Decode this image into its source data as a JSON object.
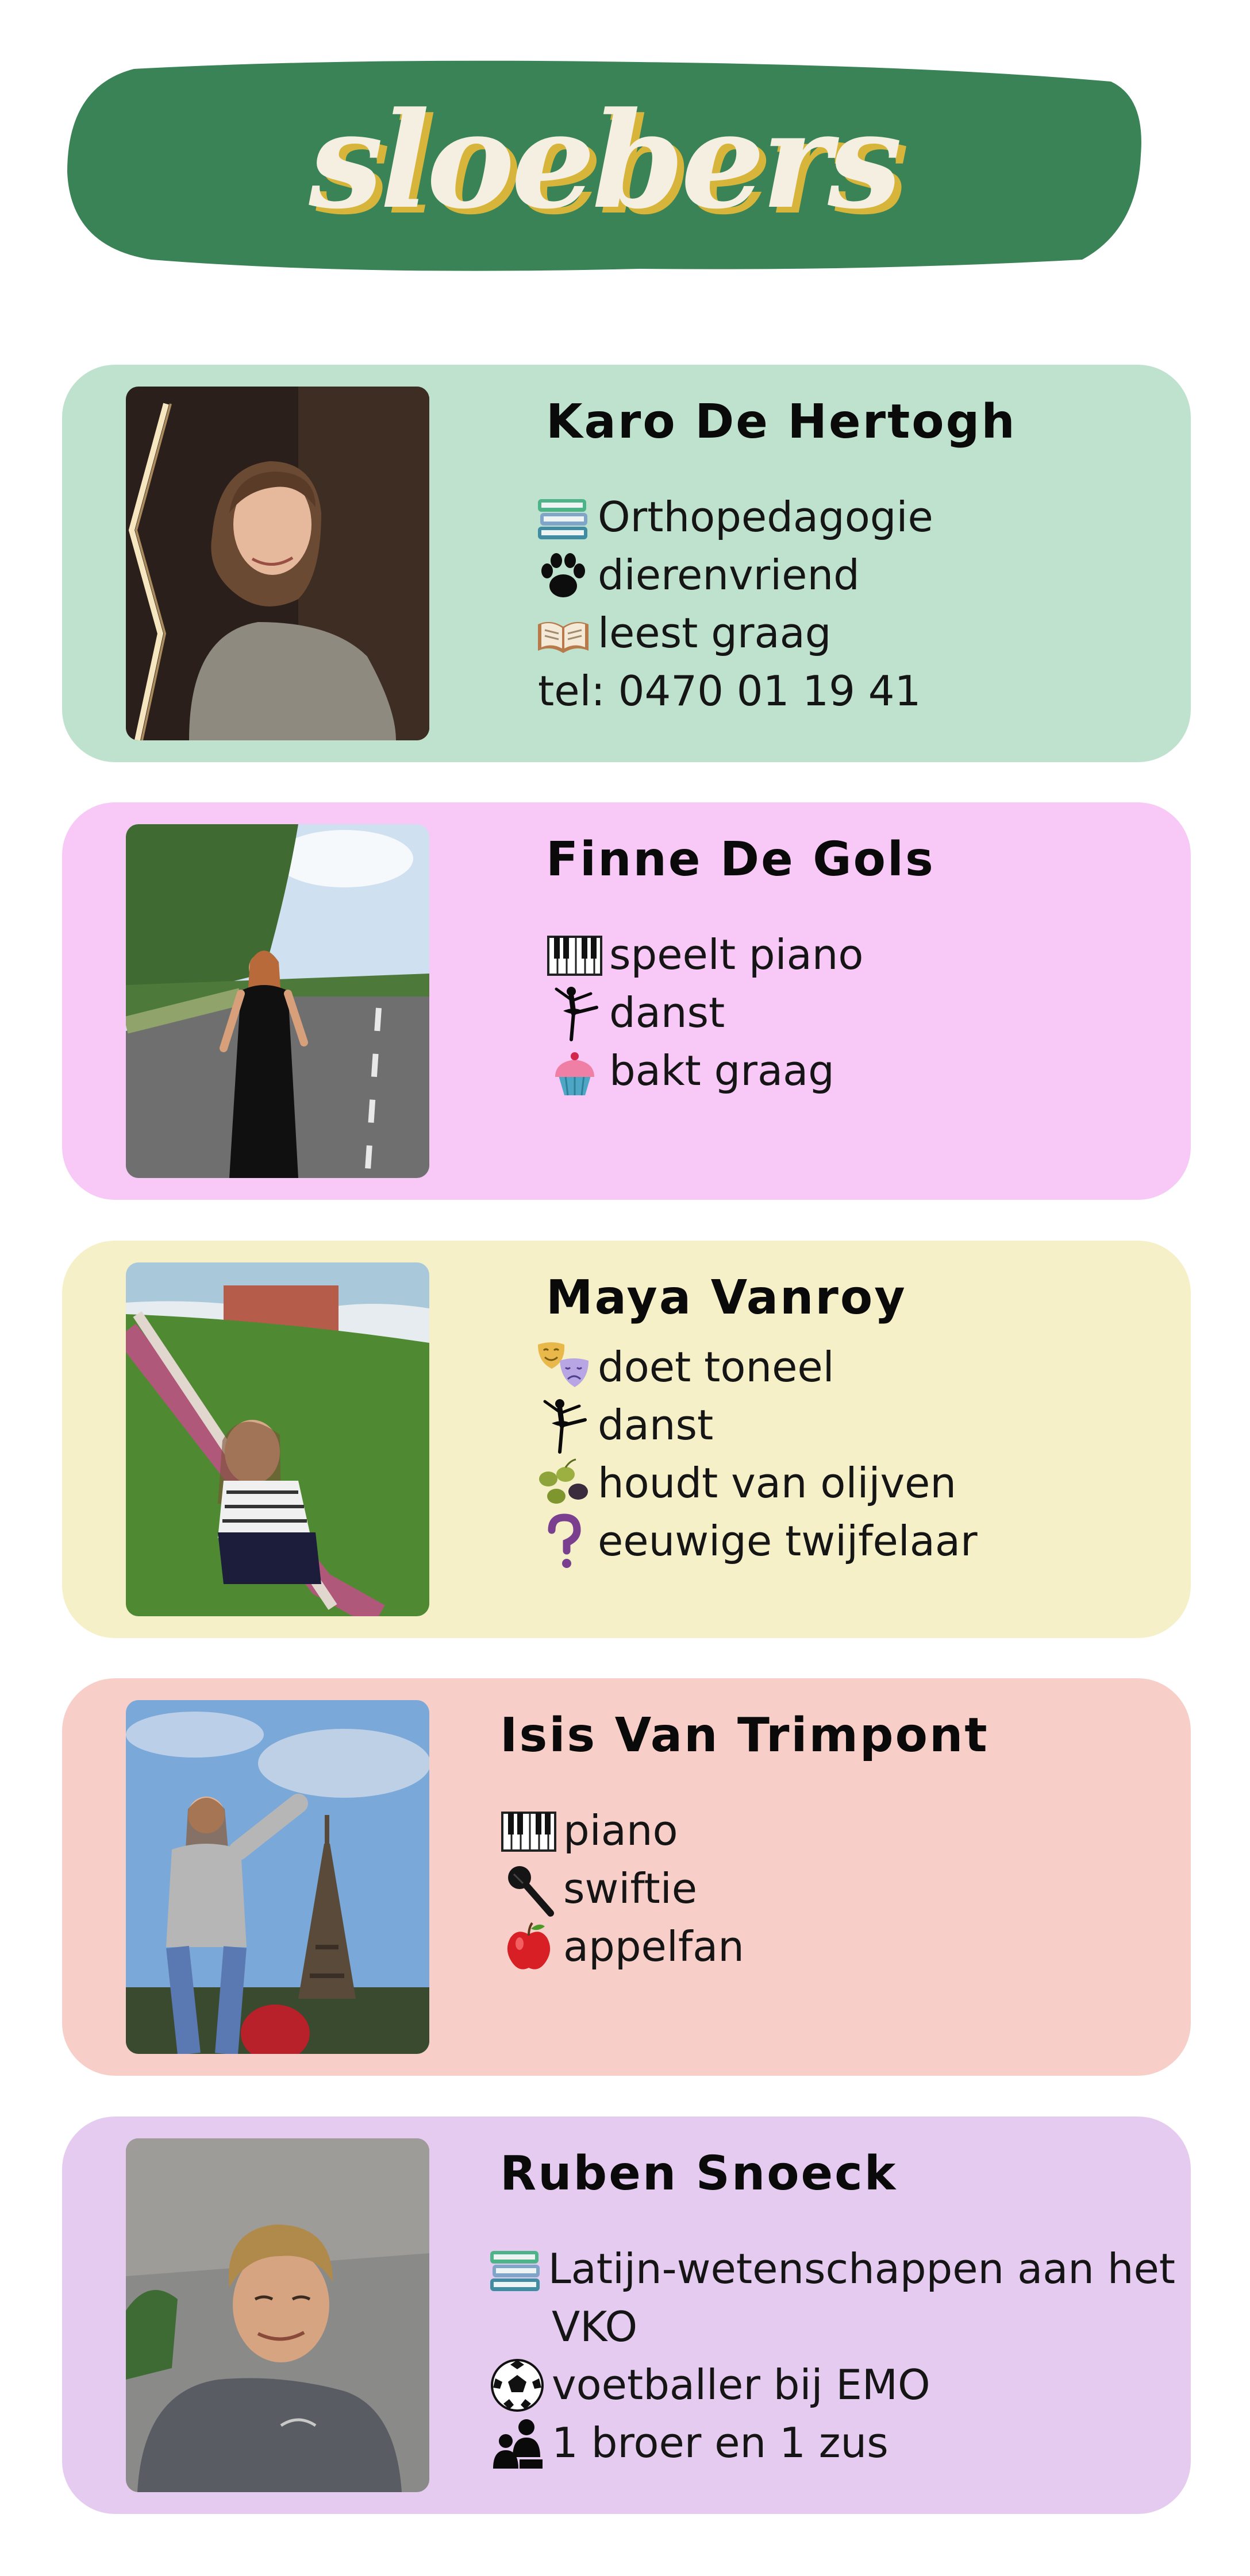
{
  "header": {
    "title": "sloebers"
  },
  "colors": {
    "banner": "#3a8357",
    "card_1": "#bfe2cf",
    "card_2": "#f8c8f6",
    "card_3": "#f5f0c7",
    "card_4": "#f8cfc8",
    "card_5": "#e6cbf0"
  },
  "members": [
    {
      "name": "Karo De Hertogh",
      "lines": [
        {
          "icon": "books-icon",
          "text": "Orthopedagogie"
        },
        {
          "icon": "paw-icon",
          "text": "dierenvriend"
        },
        {
          "icon": "open-book-icon",
          "text": "leest graag"
        },
        {
          "icon": "",
          "text": "tel: 0470 01 19 41"
        }
      ]
    },
    {
      "name": "Finne De Gols",
      "lines": [
        {
          "icon": "piano-icon",
          "text": "speelt piano"
        },
        {
          "icon": "dancer-icon",
          "text": "danst"
        },
        {
          "icon": "cupcake-icon",
          "text": "bakt graag"
        }
      ]
    },
    {
      "name": "Maya Vanroy",
      "lines": [
        {
          "icon": "theater-masks-icon",
          "text": "doet toneel"
        },
        {
          "icon": "dancer-icon",
          "text": "danst"
        },
        {
          "icon": "olives-icon",
          "text": "houdt van olijven"
        },
        {
          "icon": "question-mark-icon",
          "text": "eeuwige twijfelaar"
        }
      ]
    },
    {
      "name": "Isis Van Trimpont",
      "lines": [
        {
          "icon": "piano-icon",
          "text": "piano"
        },
        {
          "icon": "microphone-icon",
          "text": "swiftie"
        },
        {
          "icon": "apple-icon",
          "text": "appelfan"
        }
      ]
    },
    {
      "name": "Ruben Snoeck",
      "lines": [
        {
          "icon": "books-icon",
          "text": "Latijn-wetenschappen aan het"
        },
        {
          "icon": "",
          "text": "VKO"
        },
        {
          "icon": "soccer-ball-icon",
          "text": "voetballer bij EMO"
        },
        {
          "icon": "family-icon",
          "text": "1 broer en 1 zus"
        }
      ]
    }
  ]
}
